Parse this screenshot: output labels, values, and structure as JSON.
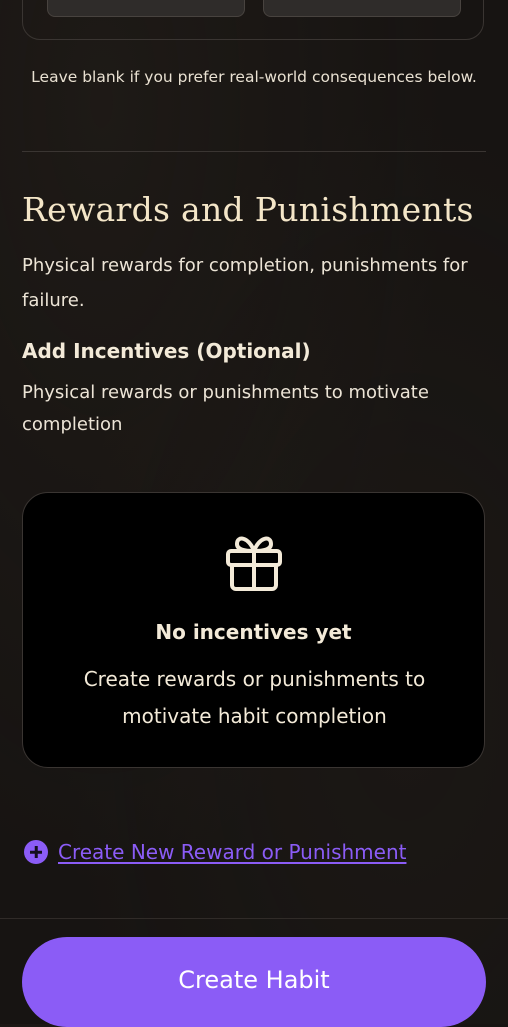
{
  "top_section": {
    "helper_text": "Leave blank if you prefer real-world consequences below."
  },
  "rewards_section": {
    "title": "Rewards and Punishments",
    "description": "Physical rewards for completion, punishments for failure.",
    "incentives_heading": "Add Incentives (Optional)",
    "incentives_description": "Physical rewards or punishments to motivate completion"
  },
  "empty_state": {
    "icon": "gift-icon",
    "title": "No incentives yet",
    "description": "Create rewards or punishments to motivate habit completion"
  },
  "create_link": {
    "icon": "plus-circle-icon",
    "label": "Create New Reward or Punishment"
  },
  "footer": {
    "primary_button_label": "Create Habit"
  },
  "colors": {
    "accent": "#8b5cf6",
    "background": "#171412",
    "card_background": "#000000",
    "text": "#f3ead8"
  }
}
